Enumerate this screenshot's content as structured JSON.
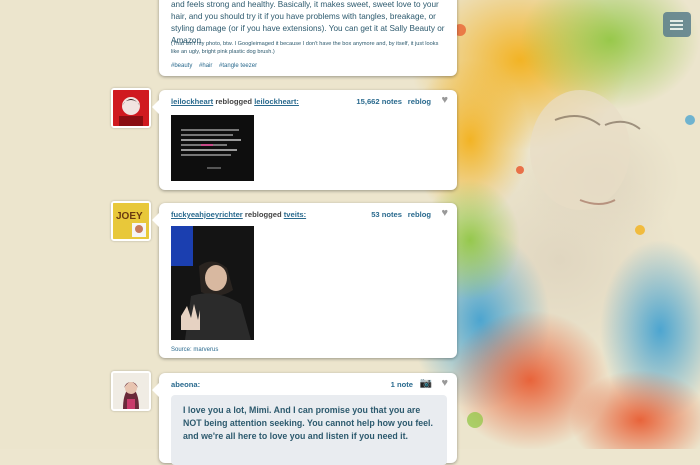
{
  "dashboard": {
    "post_hair": {
      "text": "and feels strong and healthy. Basically, it makes sweet, sweet love to your hair, and you should try it if you have problems with tangles, breakage, or styling damage (or if you have extensions). You can get it at Sally Beauty or Amazon.",
      "note": "(That isn't my photo, btw. I Googleimaged it because I don't have the box anymore and, by itself, it just looks like an ugly, bright pink plastic dog brush.)",
      "tags": [
        "#beauty",
        "#hair",
        "#tangle teezer"
      ]
    },
    "post_quote_image": {
      "user": "leilockheart",
      "action": "reblogged",
      "source_user": "leilockheart:",
      "notes": "15,662 notes",
      "reblog": "reblog",
      "heart_icon": "heart-icon"
    },
    "post_joey": {
      "user": "fuckyeahjoeyrichter",
      "action": "reblogged",
      "source_user": "tveits:",
      "notes": "53 notes",
      "reblog": "reblog",
      "heart_icon": "heart-icon",
      "source_label": "Source: marverus",
      "avatar_text": "JOEY"
    },
    "post_abeona": {
      "user": "abeona:",
      "notes": "1 note",
      "camera_icon": "camera-icon",
      "heart_icon": "heart-icon",
      "quote": "I love you a lot, Mimi. And I can promise you that you are NOT being attention seeking. You cannot help how you feel. and we're all here to love you and listen if you need it."
    }
  },
  "menu_button_icon": "menu-icon"
}
